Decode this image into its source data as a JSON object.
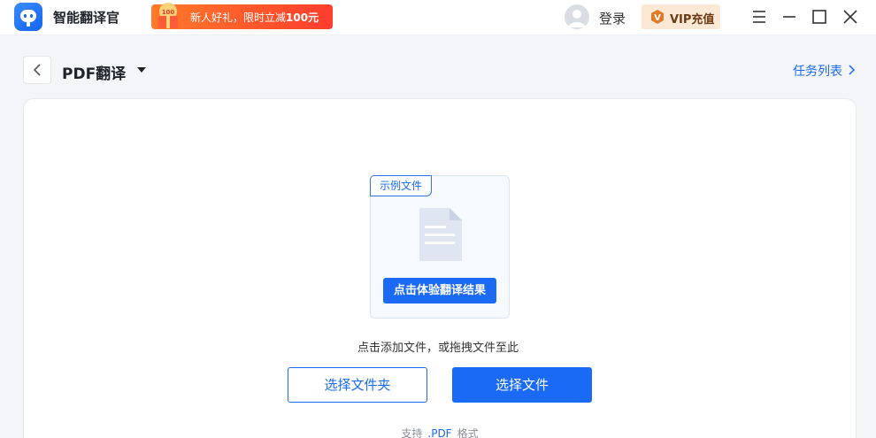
{
  "app": {
    "title": "智能翻译官",
    "accent": "#1a6af5"
  },
  "promo": {
    "text_prefix": "新人好礼，限时立减",
    "amount": "100元",
    "icon": "gift-icon"
  },
  "account": {
    "login_label": "登录",
    "vip_label": "VIP充值",
    "avatar_icon": "user-avatar-icon"
  },
  "window_controls": {
    "menu_icon": "hamburger-menu-icon",
    "minimize_icon": "minimize-icon",
    "maximize_icon": "maximize-icon",
    "close_icon": "close-icon"
  },
  "header": {
    "back_icon": "chevron-left-icon",
    "page_title": "PDF翻译",
    "dropdown_icon": "caret-down-icon",
    "task_list_label": "任务列表",
    "task_list_icon": "chevron-right-icon"
  },
  "upload": {
    "sample_tag": "示例文件",
    "sample_icon": "document-icon",
    "try_button": "点击体验翻译结果",
    "hint": "点击添加文件，或拖拽文件至此",
    "select_folder": "选择文件夹",
    "select_file": "选择文件",
    "support_prefix": "支持",
    "support_format": ".PDF",
    "support_suffix": "格式"
  }
}
